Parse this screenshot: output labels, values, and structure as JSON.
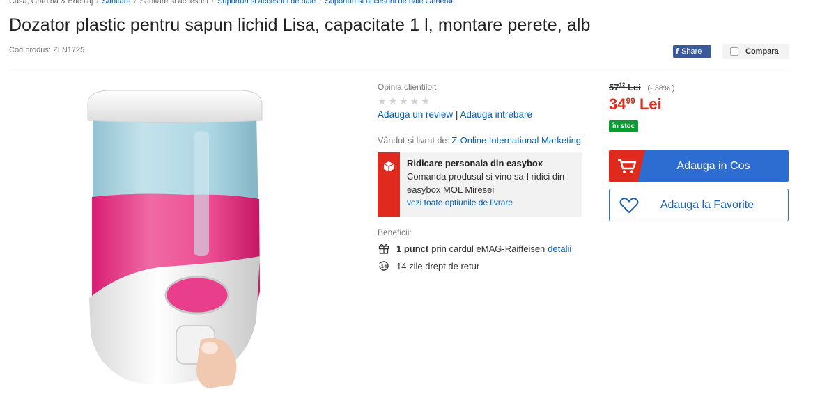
{
  "breadcrumb": {
    "items": [
      {
        "label": "Casa, Gradina & Bricolaj",
        "link": false
      },
      {
        "label": "Sanitare",
        "link": true
      },
      {
        "label": "Sanitare si accesorii",
        "link": false
      },
      {
        "label": "Suporturi si accesorii de baie",
        "link": true
      },
      {
        "label": "Suporturi si accesorii de baie General",
        "link": true
      }
    ],
    "separator": "/"
  },
  "product": {
    "title": "Dozator plastic pentru sapun lichid Lisa, capacitate 1 l, montare perete, alb",
    "code_label": "Cod produs:",
    "code": "ZLN1725"
  },
  "actions": {
    "share_icon": "f",
    "share_label": "Share",
    "compare_label": "Compara"
  },
  "reviews": {
    "label": "Opinia clientilor:",
    "rating": 0,
    "max_rating": 5,
    "add_review": "Adauga un review",
    "divider": "|",
    "add_question": "Adauga intrebare"
  },
  "seller": {
    "label": "Vândut și livrat de:",
    "name": "Z-Online International Marketing"
  },
  "easybox": {
    "title": "Ridicare personala din easybox",
    "description": "Comanda produsul si vino sa-l ridici din easybox MOL Miresei",
    "link": "vezi toate optiunile de livrare"
  },
  "benefits": {
    "label": "Beneficii:",
    "points_bold": "1 punct",
    "points_text": "prin cardul eMAG-Raiffeisen",
    "points_link": "detalii",
    "return_icon_text": "14",
    "return_text": "14 zile drept de retur"
  },
  "pricing": {
    "old_price_int": "57",
    "old_price_dec": "12",
    "old_currency": "Lei",
    "discount": "(- 38% )",
    "new_price_int": "34",
    "new_price_dec": "99",
    "currency": "Lei",
    "stock": "în stoc"
  },
  "buttons": {
    "cart": "Adauga in Cos",
    "favorite": "Adauga la Favorite"
  },
  "colors": {
    "accent_blue": "#2d6cd1",
    "brand_red": "#e02a1d",
    "stock_green": "#0a9b33",
    "facebook": "#3b5998"
  }
}
